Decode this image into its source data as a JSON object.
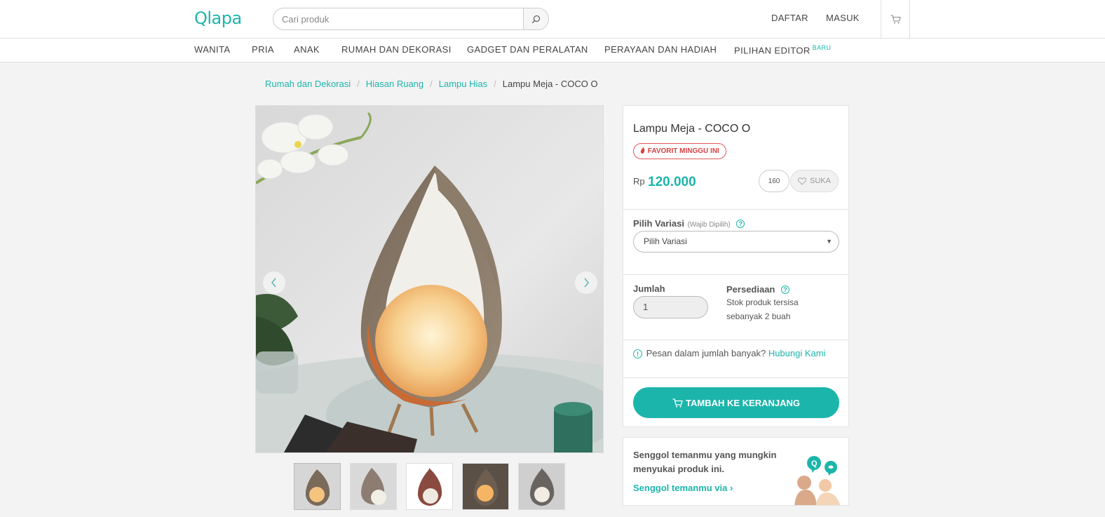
{
  "header": {
    "logo": "Qlapa",
    "search_placeholder": "Cari produk",
    "register": "DAFTAR",
    "login": "MASUK"
  },
  "categories": [
    "WANITA",
    "PRIA",
    "ANAK",
    "RUMAH DAN DEKORASI",
    "GADGET DAN PERALATAN",
    "PERAYAAN DAN HADIAH",
    "PILIHAN EDITOR"
  ],
  "categories_new_badge": "BARU",
  "breadcrumb": {
    "items": [
      "Rumah dan Dekorasi",
      "Hiasan Ruang",
      "Lampu Hias"
    ],
    "separator": "/",
    "current": "Lampu Meja - COCO O"
  },
  "gallery": {
    "thumbnail_count": 5
  },
  "product": {
    "title": "Lampu Meja - COCO O",
    "badge": "FAVORIT MINGGU INI",
    "currency": "Rp",
    "price": "120.000",
    "like_count": "160",
    "like_label": "SUKA",
    "variant_label": "Pilih Variasi",
    "variant_note": "(Wajib Dipilih)",
    "variant_selected": "Pilih Variasi",
    "qty_label": "Jumlah",
    "qty_value": "1",
    "stock_label": "Persediaan",
    "stock_text": "Stok produk tersisa sebanyak 2 buah",
    "bulk_text": "Pesan dalam jumlah banyak?",
    "bulk_link": "Hubungi Kami",
    "add_to_cart": "TAMBAH KE KERANJANG"
  },
  "share": {
    "text": "Senggol temanmu yang mungkin menyukai produk ini.",
    "link": "Senggol temanmu via"
  },
  "colors": {
    "accent": "#1cb5ab",
    "badge_red": "#d84141"
  },
  "icons": [
    "search-icon",
    "cart-icon",
    "chevron-left-icon",
    "chevron-right-icon",
    "flame-icon",
    "heart-icon",
    "help-icon",
    "info-icon",
    "chevron-down-icon"
  ]
}
